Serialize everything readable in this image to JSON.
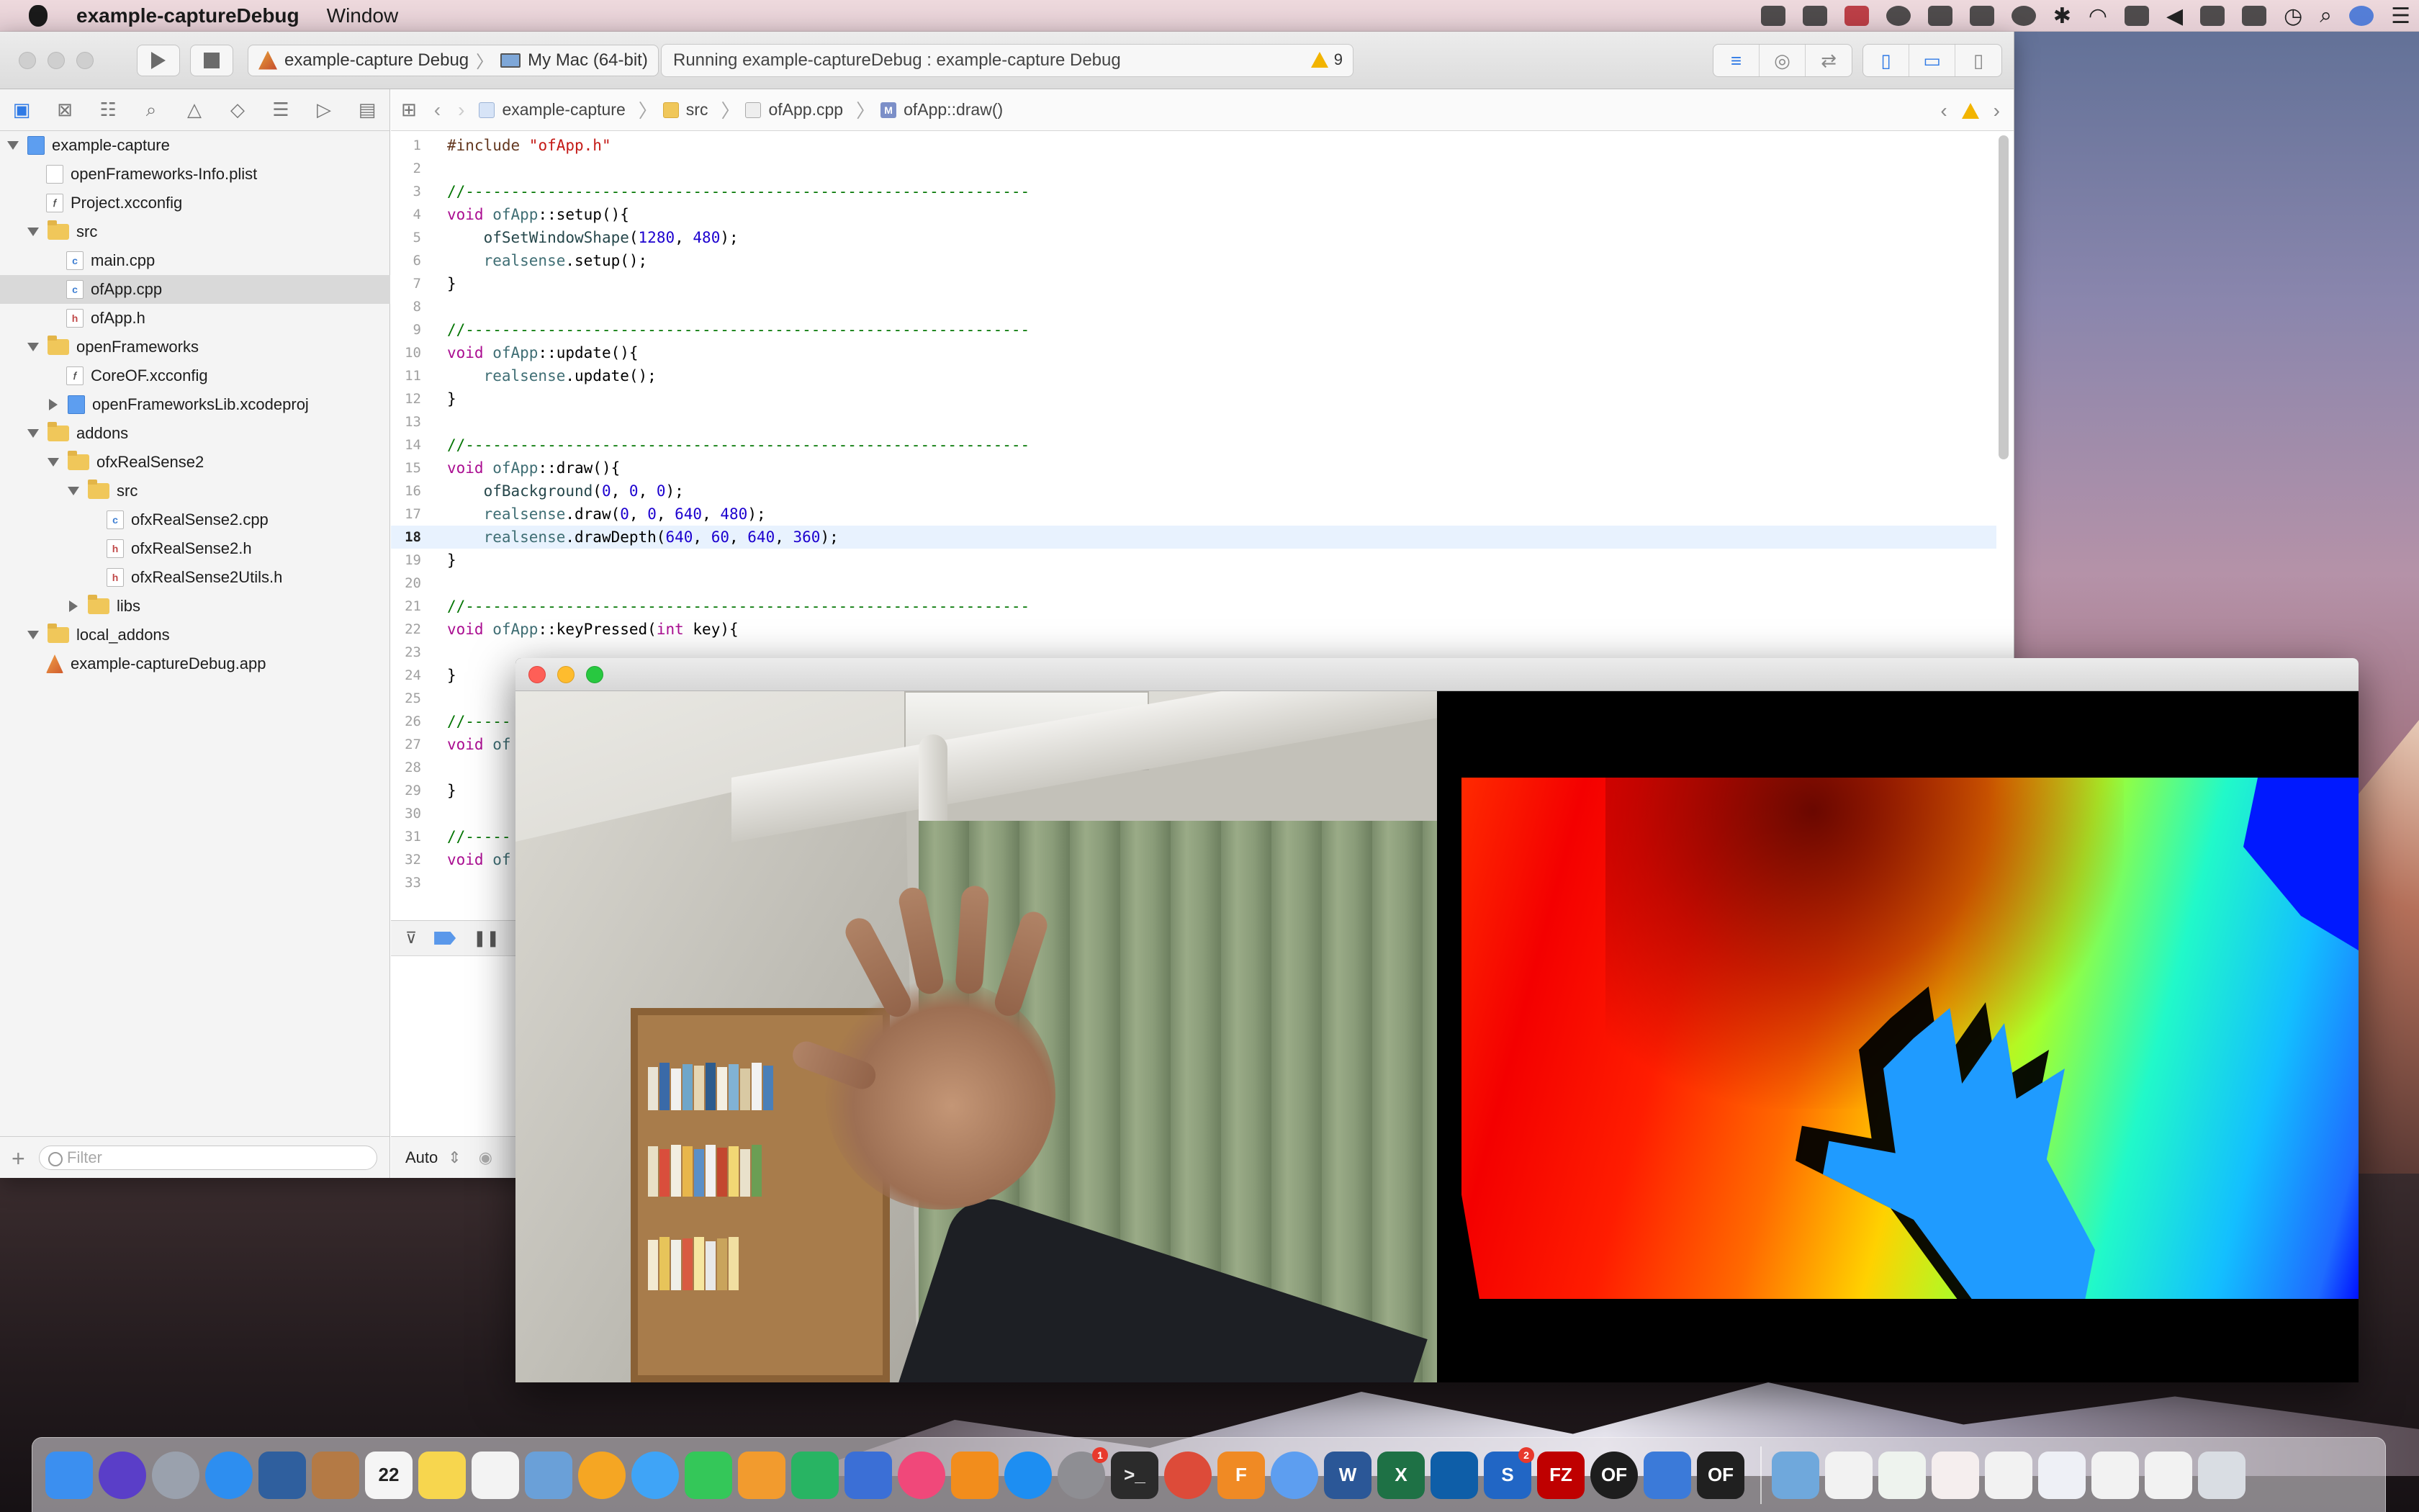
{
  "menubar": {
    "app_name": "example-captureDebug",
    "menus": [
      "Window"
    ]
  },
  "xcode": {
    "toolbar": {
      "scheme_target": "example-capture Debug",
      "scheme_device": "My Mac (64-bit)",
      "status_text": "Running example-captureDebug : example-capture Debug",
      "warning_count": "9"
    },
    "jump_bar": {
      "items": [
        "example-capture",
        "src",
        "ofApp.cpp",
        "ofApp::draw()"
      ]
    },
    "navigator": {
      "filter_placeholder": "Filter",
      "items": [
        {
          "label": "example-capture",
          "indent": 0,
          "disclosure": "open",
          "icon": "project-icon"
        },
        {
          "label": "openFrameworks-Info.plist",
          "indent": 1,
          "disclosure": "none",
          "icon": "plist-file-icon"
        },
        {
          "label": "Project.xcconfig",
          "indent": 1,
          "disclosure": "none",
          "icon": "config-file-icon"
        },
        {
          "label": "src",
          "indent": 1,
          "disclosure": "open",
          "icon": "folder-icon"
        },
        {
          "label": "main.cpp",
          "indent": 2,
          "disclosure": "none",
          "icon": "cpp-file-icon"
        },
        {
          "label": "ofApp.cpp",
          "indent": 2,
          "disclosure": "none",
          "icon": "cpp-file-icon",
          "selected": true
        },
        {
          "label": "ofApp.h",
          "indent": 2,
          "disclosure": "none",
          "icon": "header-file-icon"
        },
        {
          "label": "openFrameworks",
          "indent": 1,
          "disclosure": "open",
          "icon": "folder-icon"
        },
        {
          "label": "CoreOF.xcconfig",
          "indent": 2,
          "disclosure": "none",
          "icon": "config-file-icon"
        },
        {
          "label": "openFrameworksLib.xcodeproj",
          "indent": 2,
          "disclosure": "closed",
          "icon": "project-icon"
        },
        {
          "label": "addons",
          "indent": 1,
          "disclosure": "open",
          "icon": "folder-icon"
        },
        {
          "label": "ofxRealSense2",
          "indent": 2,
          "disclosure": "open",
          "icon": "folder-icon"
        },
        {
          "label": "src",
          "indent": 3,
          "disclosure": "open",
          "icon": "folder-icon"
        },
        {
          "label": "ofxRealSense2.cpp",
          "indent": 4,
          "disclosure": "none",
          "icon": "cpp-file-icon"
        },
        {
          "label": "ofxRealSense2.h",
          "indent": 4,
          "disclosure": "none",
          "icon": "header-file-icon"
        },
        {
          "label": "ofxRealSense2Utils.h",
          "indent": 4,
          "disclosure": "none",
          "icon": "header-file-icon"
        },
        {
          "label": "libs",
          "indent": 3,
          "disclosure": "closed",
          "icon": "folder-icon"
        },
        {
          "label": "local_addons",
          "indent": 1,
          "disclosure": "open",
          "icon": "folder-icon"
        },
        {
          "label": "example-captureDebug.app",
          "indent": 1,
          "disclosure": "none",
          "icon": "app-icon"
        }
      ]
    },
    "editor": {
      "current_line": 18,
      "lines": [
        {
          "n": "1",
          "html": "<span class='pp'>#include </span><span class='str'>\"ofApp.h\"</span>"
        },
        {
          "n": "2",
          "html": ""
        },
        {
          "n": "3",
          "html": "<span class='cm'>//--------------------------------------------------------------</span>"
        },
        {
          "n": "4",
          "html": "<span class='kw'>void</span> <span class='cls'>ofApp</span>::setup(){"
        },
        {
          "n": "5",
          "html": "    <span class='fn'>ofSetWindowShape</span>(<span class='num'>1280</span>, <span class='num'>480</span>);"
        },
        {
          "n": "6",
          "html": "    <span class='cls'>realsense</span>.setup();"
        },
        {
          "n": "7",
          "html": "}"
        },
        {
          "n": "8",
          "html": ""
        },
        {
          "n": "9",
          "html": "<span class='cm'>//--------------------------------------------------------------</span>"
        },
        {
          "n": "10",
          "html": "<span class='kw'>void</span> <span class='cls'>ofApp</span>::update(){"
        },
        {
          "n": "11",
          "html": "    <span class='cls'>realsense</span>.update();"
        },
        {
          "n": "12",
          "html": "}"
        },
        {
          "n": "13",
          "html": ""
        },
        {
          "n": "14",
          "html": "<span class='cm'>//--------------------------------------------------------------</span>"
        },
        {
          "n": "15",
          "html": "<span class='kw'>void</span> <span class='cls'>ofApp</span>::draw(){"
        },
        {
          "n": "16",
          "html": "    <span class='fn'>ofBackground</span>(<span class='num'>0</span>, <span class='num'>0</span>, <span class='num'>0</span>);"
        },
        {
          "n": "17",
          "html": "    <span class='cls'>realsense</span>.draw(<span class='num'>0</span>, <span class='num'>0</span>, <span class='num'>640</span>, <span class='num'>480</span>);"
        },
        {
          "n": "18",
          "html": "    <span class='cls'>realsense</span>.drawDepth(<span class='num'>640</span>, <span class='num'>60</span>, <span class='num'>640</span>, <span class='num'>360</span>);"
        },
        {
          "n": "19",
          "html": "}"
        },
        {
          "n": "20",
          "html": ""
        },
        {
          "n": "21",
          "html": "<span class='cm'>//--------------------------------------------------------------</span>"
        },
        {
          "n": "22",
          "html": "<span class='kw'>void</span> <span class='cls'>ofApp</span>::keyPressed(<span class='kw'>int</span> key){"
        },
        {
          "n": "23",
          "html": ""
        },
        {
          "n": "24",
          "html": "}"
        },
        {
          "n": "25",
          "html": ""
        },
        {
          "n": "26",
          "html": "<span class='cm'>//-----</span>"
        },
        {
          "n": "27",
          "html": "<span class='kw'>void</span> <span class='cls'>of</span>"
        },
        {
          "n": "28",
          "html": ""
        },
        {
          "n": "29",
          "html": "}"
        },
        {
          "n": "30",
          "html": ""
        },
        {
          "n": "31",
          "html": "<span class='cm'>//-----</span>"
        },
        {
          "n": "32",
          "html": "<span class='kw'>void</span> <span class='cls'>of</span>"
        },
        {
          "n": "33",
          "html": ""
        }
      ]
    },
    "console": {
      "mode_label": "Auto"
    }
  },
  "dock": {
    "apps": [
      {
        "name": "finder-icon",
        "color": "#3b8ff0"
      },
      {
        "name": "siri-icon",
        "color": "#5a3ec8",
        "round": true
      },
      {
        "name": "launchpad-icon",
        "color": "#9aa1ad",
        "round": true
      },
      {
        "name": "safari-icon",
        "color": "#2d8ef0",
        "round": true
      },
      {
        "name": "virtualbox-icon",
        "color": "#2f5f9e"
      },
      {
        "name": "contacts-icon",
        "color": "#b47a45"
      },
      {
        "name": "calendar-icon",
        "color": "#f5f5f5",
        "text": "22",
        "text_color": "#222"
      },
      {
        "name": "notes-icon",
        "color": "#f7d64e"
      },
      {
        "name": "reminders-icon",
        "color": "#f3f3f3"
      },
      {
        "name": "preview-icon",
        "color": "#6aa0d8"
      },
      {
        "name": "photos-icon",
        "color": "#f5a623",
        "round": true
      },
      {
        "name": "messages-icon",
        "color": "#3fa4f7",
        "round": true
      },
      {
        "name": "facetime-icon",
        "color": "#34c759"
      },
      {
        "name": "pages-icon",
        "color": "#f29b2e"
      },
      {
        "name": "numbers-icon",
        "color": "#28b463"
      },
      {
        "name": "keynote-icon",
        "color": "#3b6fd6"
      },
      {
        "name": "itunes-icon",
        "color": "#f0487a",
        "round": true
      },
      {
        "name": "ibooks-icon",
        "color": "#f28d1c"
      },
      {
        "name": "appstore-icon",
        "color": "#1d8ef2",
        "round": true
      },
      {
        "name": "system-preferences-icon",
        "color": "#8e8e93",
        "round": true,
        "badge": "1"
      },
      {
        "name": "terminal-icon",
        "color": "#2b2b2b",
        "text": ">_",
        "text_color": "#eaeaea"
      },
      {
        "name": "chrome-icon",
        "color": "#dd4b39",
        "round": true
      },
      {
        "name": "fusion360-icon",
        "color": "#f08a24",
        "text": "F"
      },
      {
        "name": "xcode-helper-icon",
        "color": "#5d9ef0",
        "round": true
      },
      {
        "name": "word-icon",
        "color": "#2b5797",
        "text": "W"
      },
      {
        "name": "excel-icon",
        "color": "#1e7145",
        "text": "X"
      },
      {
        "name": "vscode-icon",
        "color": "#0e5ea8"
      },
      {
        "name": "sourcetree-icon",
        "color": "#2166c5",
        "text": "S",
        "badge": "2"
      },
      {
        "name": "filezilla-icon",
        "color": "#bf0000",
        "text": "FZ"
      },
      {
        "name": "openframeworks-icon",
        "color": "#1d1d1d",
        "text": "OF",
        "round": true
      },
      {
        "name": "xcode-icon",
        "color": "#3b7ad9"
      },
      {
        "name": "projectgenerator-icon",
        "color": "#202020",
        "text": "OF"
      }
    ],
    "docs": [
      {
        "name": "downloads-folder-icon",
        "color": "#6fa8dc"
      },
      {
        "name": "document-thumbnail-icon",
        "color": "#f2f2f2"
      },
      {
        "name": "document-thumbnail-icon",
        "color": "#eef3ee"
      },
      {
        "name": "document-thumbnail-icon",
        "color": "#f5eeee"
      },
      {
        "name": "document-thumbnail-icon",
        "color": "#f2f2f2"
      },
      {
        "name": "document-thumbnail-icon",
        "color": "#eef0f6"
      },
      {
        "name": "document-thumbnail-icon",
        "color": "#f2f2f2"
      },
      {
        "name": "document-thumbnail-icon",
        "color": "#f2f2f2"
      },
      {
        "name": "trash-icon",
        "color": "#d9dde3"
      }
    ]
  }
}
